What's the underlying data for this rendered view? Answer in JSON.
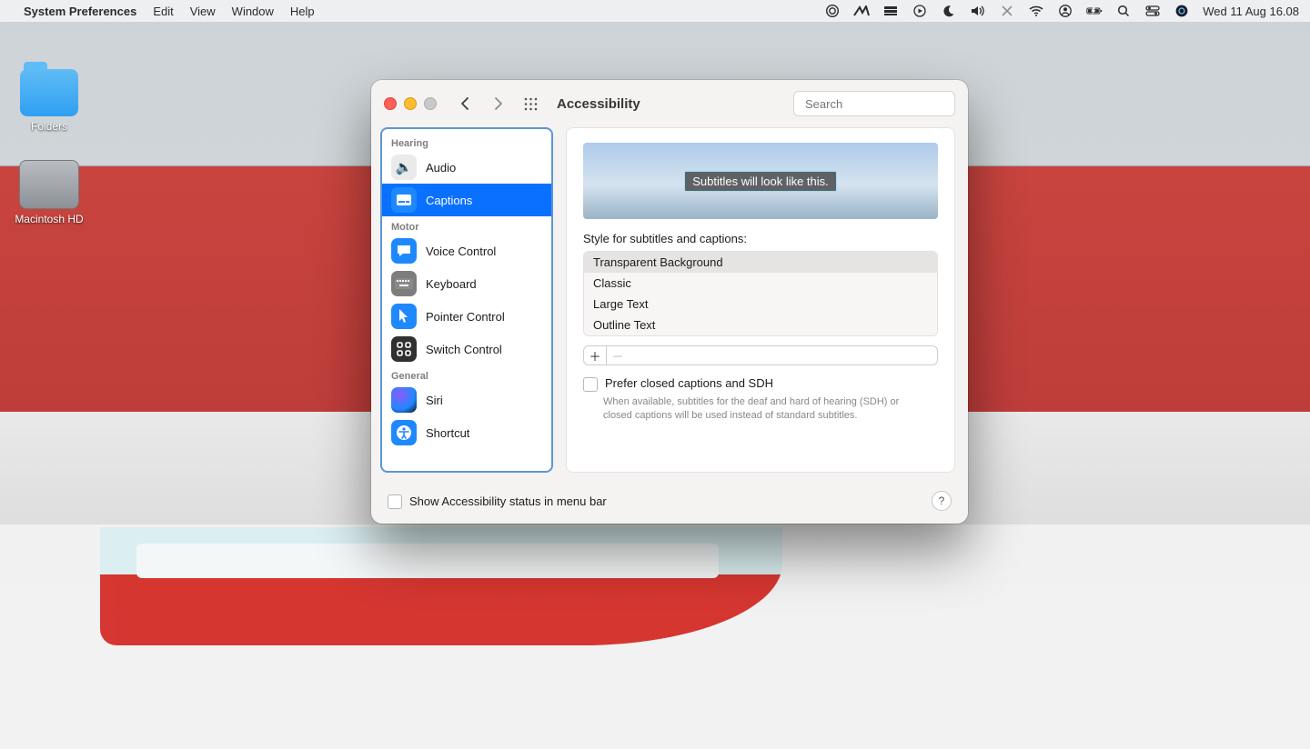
{
  "menubar": {
    "app_name": "System Preferences",
    "items": [
      "Edit",
      "View",
      "Window",
      "Help"
    ],
    "clock": "Wed 11 Aug  16.08"
  },
  "desktop_icons": {
    "folders_label": "Folders",
    "hdd_label": "Macintosh HD"
  },
  "window": {
    "title": "Accessibility",
    "search_placeholder": "Search",
    "footer_checkbox_label": "Show Accessibility status in menu bar"
  },
  "sidebar": {
    "groups": {
      "hearing": "Hearing",
      "motor": "Motor",
      "general": "General"
    },
    "items": {
      "audio": "Audio",
      "captions": "Captions",
      "voice_control": "Voice Control",
      "keyboard": "Keyboard",
      "pointer_control": "Pointer Control",
      "switch_control": "Switch Control",
      "siri": "Siri",
      "shortcut": "Shortcut"
    },
    "selected": "captions"
  },
  "captions_pane": {
    "preview_text": "Subtitles will look like this.",
    "styles_label": "Style for subtitles and captions:",
    "styles": [
      "Transparent Background",
      "Classic",
      "Large Text",
      "Outline Text"
    ],
    "styles_selected_index": 0,
    "prefer_sdh_label": "Prefer closed captions and SDH",
    "prefer_sdh_hint": "When available, subtitles for the deaf and hard of hearing (SDH) or closed captions will be used instead of standard subtitles.",
    "prefer_sdh_checked": false
  }
}
